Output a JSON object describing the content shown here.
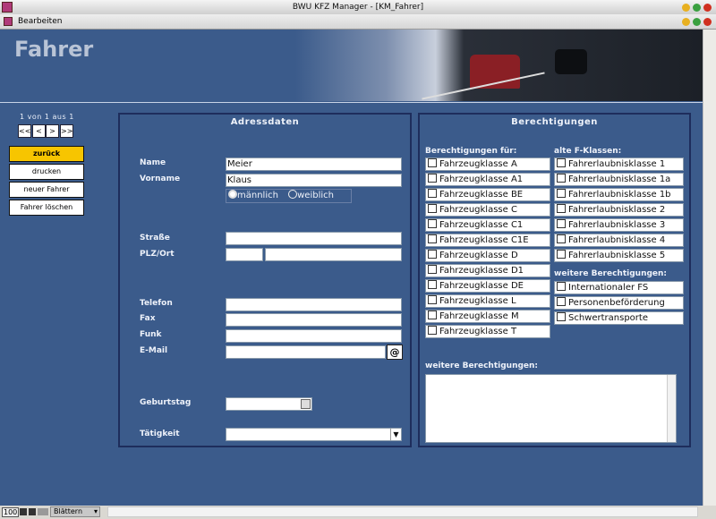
{
  "window": {
    "title": "BWU KFZ Manager - [KM_Fahrer]",
    "menu": [
      "Bearbeiten"
    ]
  },
  "header": {
    "title": "Fahrer"
  },
  "nav": {
    "record_info": "1 von 1 aus 1",
    "buttons": [
      "<<",
      "<",
      ">",
      ">>"
    ]
  },
  "sidebar": {
    "buttons": [
      {
        "label": "zurück",
        "color": "#f7c500"
      },
      {
        "label": "drucken"
      },
      {
        "label": "neuer Fahrer"
      },
      {
        "label": "Fahrer löschen"
      }
    ]
  },
  "adress": {
    "title": "Adressdaten",
    "name_label": "Name",
    "name_value": "Meier",
    "vorname_label": "Vorname",
    "vorname_value": "Klaus",
    "gender": {
      "options": [
        "männlich",
        "weiblich"
      ],
      "selected": "männlich"
    },
    "strasse_label": "Straße",
    "strasse_value": "",
    "plz_label": "PLZ/Ort",
    "plz_value": "",
    "ort_value": "",
    "telefon_label": "Telefon",
    "fax_label": "Fax",
    "funk_label": "Funk",
    "email_label": "E-Mail",
    "email_button": "@",
    "geburtstag_label": "Geburtstag",
    "taetigkeit_label": "Tätigkeit"
  },
  "berechtigungen": {
    "title": "Berechtigungen",
    "col1_label": "Berechtigungen für:",
    "col1": [
      "Fahrzeugklasse A",
      "Fahrzeugklasse  A1",
      "Fahrzeugklasse BE",
      "Fahrzeugklasse C",
      "Fahrzeugklasse C1",
      "Fahrzeugklasse C1E",
      "Fahrzeugklasse D",
      "Fahrzeugklasse D1",
      "Fahrzeugklasse DE",
      "Fahrzeugklasse L",
      "Fahrzeugklasse M",
      "Fahrzeugklasse T"
    ],
    "col2_label": "alte F-Klassen:",
    "col2": [
      "Fahrerlaubnisklasse 1",
      "Fahrerlaubnisklasse 1a",
      "Fahrerlaubnisklasse 1b",
      "Fahrerlaubnisklasse 2",
      "Fahrerlaubnisklasse 3",
      "Fahrerlaubnisklasse 4",
      "Fahrerlaubnisklasse 5"
    ],
    "weitere_label": "weitere Berechtigungen:",
    "weitere": [
      "Internationaler FS",
      "Personenbeförderung",
      "Schwertransporte"
    ],
    "notes_label": "weitere Berechtigungen:"
  },
  "status": {
    "zoom": "100",
    "mode": "Blättern"
  }
}
